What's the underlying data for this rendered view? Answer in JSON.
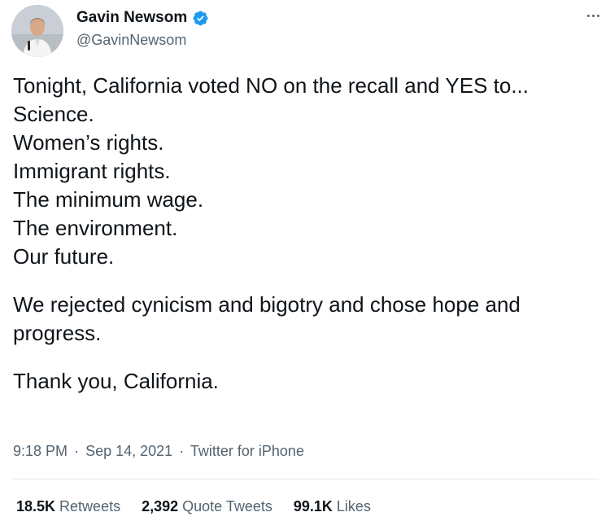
{
  "author": {
    "display_name": "Gavin Newsom",
    "handle": "@GavinNewsom",
    "verified_icon": "verified-badge-icon",
    "avatar_icon": "avatar-photo"
  },
  "more_icon": "more-options-icon",
  "tweet": {
    "lines": [
      "Tonight, California voted NO on the recall and YES to...",
      "Science.",
      "Women’s rights.",
      "Immigrant rights.",
      "The minimum wage.",
      "The environment.",
      "Our future."
    ],
    "paragraph_2": "We rejected cynicism and bigotry and chose hope and progress.",
    "paragraph_3": "Thank you, California."
  },
  "meta": {
    "time": "9:18 PM",
    "separator": "·",
    "date": "Sep 14, 2021",
    "source": "Twitter for iPhone"
  },
  "stats": {
    "retweets_count": "18.5K",
    "retweets_label": "Retweets",
    "quotes_count": "2,392",
    "quotes_label": "Quote Tweets",
    "likes_count": "99.1K",
    "likes_label": "Likes"
  },
  "colors": {
    "verified_blue": "#1d9bf0",
    "secondary_text": "#536471",
    "primary_text": "#0f1419"
  }
}
